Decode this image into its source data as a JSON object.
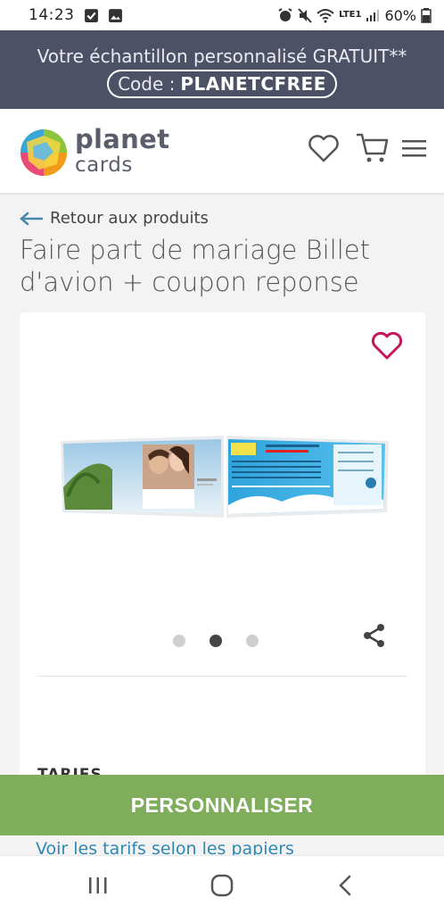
{
  "status_bar": {
    "time": "14:23",
    "battery": "60%",
    "network": "LTE1"
  },
  "promo": {
    "text": "Votre échantillon personnalisé GRATUIT**",
    "code_label": "Code :",
    "code_value": "PLANETCFREE"
  },
  "header": {
    "logo_line1": "planet",
    "logo_line2": "cards"
  },
  "breadcrumb": {
    "back_label": "Retour aux produits"
  },
  "product": {
    "title": "Faire part de mariage Billet d'avion + coupon reponse",
    "carousel_count": 3,
    "carousel_active": 2
  },
  "sections": {
    "tarifs_heading": "TARIFS",
    "papers_link": "Voir les tarifs selon les papiers"
  },
  "cta": {
    "label": "PERSONNALISER"
  },
  "colors": {
    "promo_bg": "#4d5165",
    "cta_bg": "#7fad5b",
    "heart_pink": "#c2185b",
    "link_blue": "#2d88b3"
  }
}
